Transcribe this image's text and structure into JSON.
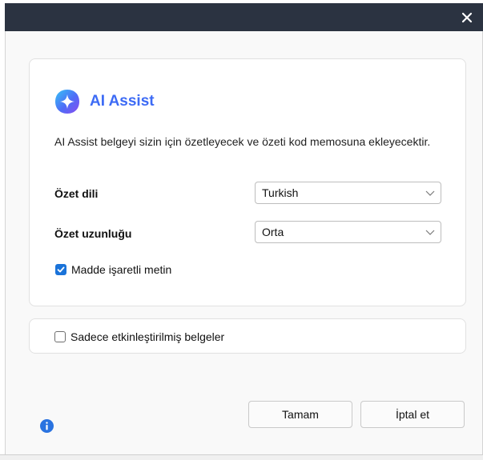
{
  "dialog": {
    "close_icon": "close-icon"
  },
  "assist": {
    "icon": "ai-assist-sparkle-icon",
    "title": "AI Assist",
    "brand_color": "#3d6bf5",
    "description": "AI Assist belgeyi sizin için özetleyecek ve özeti kod memosuna ekleyecektir."
  },
  "summary_language": {
    "label": "Özet dili",
    "selected": "Turkish"
  },
  "summary_length": {
    "label": "Özet uzunluğu",
    "selected": "Orta"
  },
  "bulleted_text": {
    "label": "Madde işaretli metin",
    "checked": true
  },
  "only_activated": {
    "label": "Sadece etkinleştirilmiş belgeler",
    "checked": false
  },
  "footer": {
    "info_icon": "info-icon",
    "ok_label": "Tamam",
    "cancel_label": "İptal et"
  },
  "colors": {
    "titlebar": "#2b3341",
    "checkbox_accent": "#1a73d9"
  }
}
